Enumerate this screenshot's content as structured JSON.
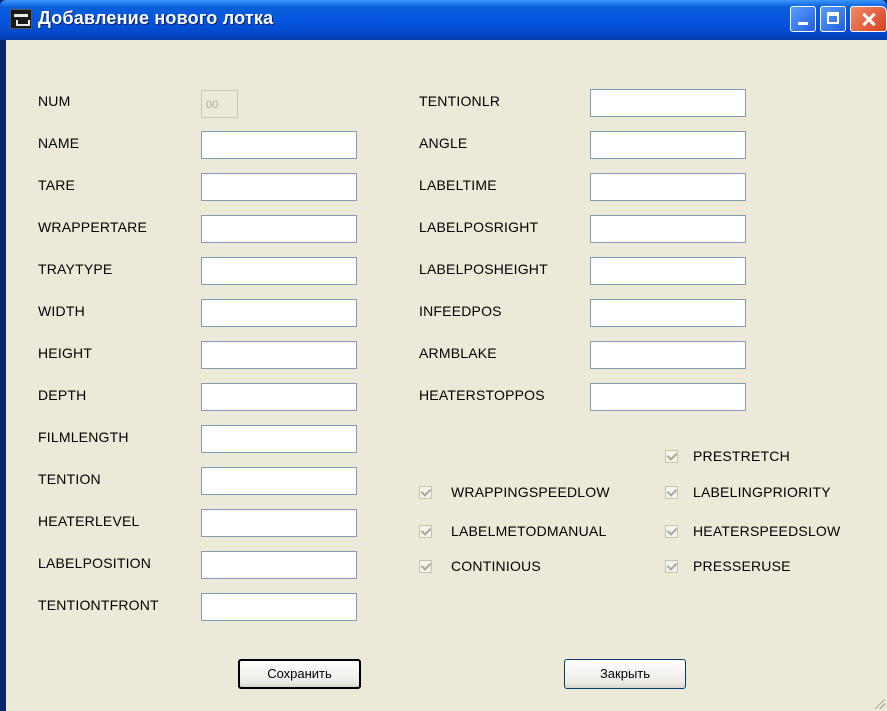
{
  "window": {
    "title": "Добавление нового лотка"
  },
  "left_fields": [
    {
      "label": "NUM",
      "value": "00",
      "disabled": true
    },
    {
      "label": "NAME",
      "value": ""
    },
    {
      "label": "TARE",
      "value": ""
    },
    {
      "label": "WRAPPERTARE",
      "value": ""
    },
    {
      "label": "TRAYTYPE",
      "value": ""
    },
    {
      "label": "WIDTH",
      "value": ""
    },
    {
      "label": "HEIGHT",
      "value": ""
    },
    {
      "label": "DEPTH",
      "value": ""
    },
    {
      "label": "FILMLENGTH",
      "value": ""
    },
    {
      "label": "TENTION",
      "value": ""
    },
    {
      "label": "HEATERLEVEL",
      "value": ""
    },
    {
      "label": "LABELPOSITION",
      "value": ""
    },
    {
      "label": "TENTIONTFRONT",
      "value": ""
    }
  ],
  "right_fields": [
    {
      "label": "TENTIONLR",
      "value": ""
    },
    {
      "label": "ANGLE",
      "value": ""
    },
    {
      "label": "LABELTIME",
      "value": ""
    },
    {
      "label": "LABELPOSRIGHT",
      "value": ""
    },
    {
      "label": "LABELPOSHEIGHT",
      "value": ""
    },
    {
      "label": "INFEEDPOS",
      "value": ""
    },
    {
      "label": "ARMBLAKE",
      "value": ""
    },
    {
      "label": "HEATERSTOPPOS",
      "value": ""
    }
  ],
  "checkboxes": [
    {
      "label": "PRESTRETCH",
      "checked": true,
      "enabled": false
    },
    {
      "label": "WRAPPINGSPEEDLOW",
      "checked": true,
      "enabled": false
    },
    {
      "label": "LABELINGPRIORITY",
      "checked": true,
      "enabled": false
    },
    {
      "label": "LABELMETODMANUAL",
      "checked": true,
      "enabled": false
    },
    {
      "label": "HEATERSPEEDSLOW",
      "checked": true,
      "enabled": false
    },
    {
      "label": "CONTINIOUS",
      "checked": true,
      "enabled": false
    },
    {
      "label": "PRESSERUSE",
      "checked": true,
      "enabled": false
    }
  ],
  "buttons": {
    "save": "Сохранить",
    "close": "Закрыть"
  }
}
